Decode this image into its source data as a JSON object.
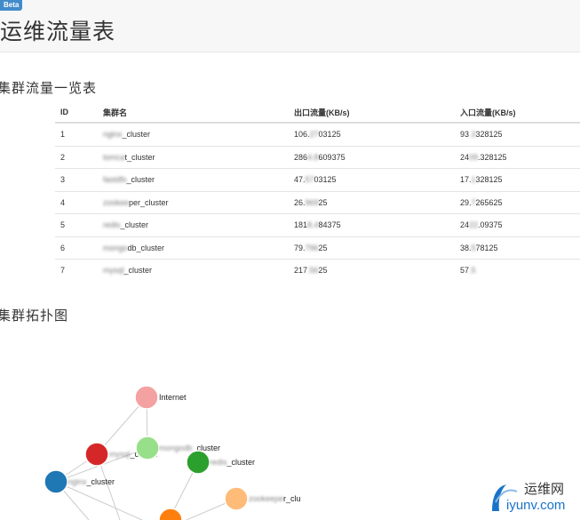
{
  "header": {
    "badge": "Beta",
    "title": "运维流量表"
  },
  "table_section": {
    "title": "集群流量一览表"
  },
  "table": {
    "columns": [
      "ID",
      "集群名",
      "出口流量(KB/s)",
      "入口流量(KB/s)"
    ],
    "rows": [
      {
        "id": "1",
        "name_hidden": "nginx",
        "name_suffix": "_cluster",
        "out_a": "106.",
        "out_hidden": "27",
        "out_b": "03125",
        "in_a": "93",
        "in_hidden": ".3",
        "in_b": "328125"
      },
      {
        "id": "2",
        "name_hidden": "tomca",
        "name_suffix": "t_cluster",
        "out_a": "286",
        "out_hidden": "4.8",
        "out_b": "609375",
        "in_a": "24",
        "in_hidden": "09",
        "in_b": ".328125"
      },
      {
        "id": "3",
        "name_hidden": "fastdfs",
        "name_suffix": "_cluster",
        "out_a": "47.",
        "out_hidden": "57",
        "out_b": "03125",
        "in_a": "17.",
        "in_hidden": "1",
        "in_b": "328125"
      },
      {
        "id": "4",
        "name_hidden": "zookee",
        "name_suffix": "per_cluster",
        "out_a": "26.",
        "out_hidden": "969",
        "out_b": "25",
        "in_a": "29.",
        "in_hidden": "7",
        "in_b": "265625"
      },
      {
        "id": "5",
        "name_hidden": "redis",
        "name_suffix": "_cluster",
        "out_a": "181",
        "out_hidden": "8.4",
        "out_b": "84375",
        "in_a": "24",
        "in_hidden": "22",
        "in_b": ".09375"
      },
      {
        "id": "6",
        "name_hidden": "mongo",
        "name_suffix": "db_cluster",
        "out_a": "79.",
        "out_hidden": "796",
        "out_b": "25",
        "in_a": "38.",
        "in_hidden": "5",
        "in_b": "78125"
      },
      {
        "id": "7",
        "name_hidden": "mysql",
        "name_suffix": "_cluster",
        "out_a": "217",
        "out_hidden": ".56",
        "out_b": "25",
        "in_a": "57",
        "in_hidden": ".5",
        "in_b": ""
      }
    ]
  },
  "topology_section": {
    "title": "集群拓扑图"
  },
  "topology": {
    "nodes": [
      {
        "name": "internet",
        "color": "#f4a1a1",
        "label": "Internet",
        "label_hidden": ""
      },
      {
        "name": "mysql",
        "color": "#d62728",
        "label": "_cluster",
        "label_hidden": "mysql"
      },
      {
        "name": "mongodb",
        "color": "#98df8a",
        "label": "_cluster",
        "label_hidden": "mongodb"
      },
      {
        "name": "redis",
        "color": "#2ca02c",
        "label": "_cluster",
        "label_hidden": "redis"
      },
      {
        "name": "nginx",
        "color": "#1f77b4",
        "label": "_cluster",
        "label_hidden": "nginx"
      },
      {
        "name": "zookeeper",
        "color": "#ffbb78",
        "label": "r_clu",
        "label_hidden": "zookeepe"
      },
      {
        "name": "orange",
        "color": "#ff7f0e",
        "label": "",
        "label_hidden": ""
      }
    ]
  },
  "logo": {
    "text": "运维网",
    "url_text": "iyunv.com",
    "color": "#1a73c9"
  }
}
